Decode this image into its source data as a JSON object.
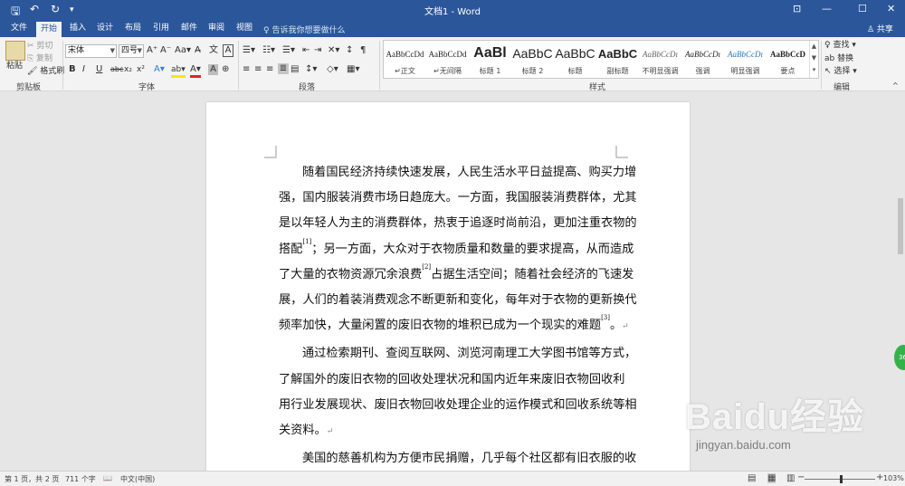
{
  "window": {
    "title": "文档1 - Word",
    "quick_access": {
      "save": "🖫",
      "undo": "↶",
      "redo": "↻",
      "customize": "▾"
    },
    "controls": {
      "ribbon_options": "⊡",
      "minimize": "—",
      "maximize": "☐",
      "close": "✕"
    }
  },
  "tabs": [
    {
      "label": "文件"
    },
    {
      "label": "开始"
    },
    {
      "label": "插入"
    },
    {
      "label": "设计"
    },
    {
      "label": "布局"
    },
    {
      "label": "引用"
    },
    {
      "label": "邮件"
    },
    {
      "label": "审阅"
    },
    {
      "label": "视图"
    }
  ],
  "tell_me": "♀ 告诉我你想要做什么",
  "share": "♙ 共享",
  "ribbon": {
    "clipboard": {
      "label": "剪贴板",
      "paste": "粘贴",
      "cut": "✂ 剪切",
      "copy": "⎘ 复制",
      "format_painter": "🖌 格式刷"
    },
    "font": {
      "label": "字体",
      "font_name": "宋体",
      "font_size": "四号",
      "grow": "A⁺",
      "shrink": "A⁻",
      "case": "Aa▾",
      "clear": "A̶",
      "phonetic": "文",
      "border_char": "A",
      "bold": "B",
      "italic": "I",
      "underline": "U",
      "strike": "abc",
      "subscript": "x₂",
      "superscript": "x²",
      "effects": "A▾",
      "highlight": "ab▾",
      "font_color": "A▾",
      "shading": "A",
      "enclose": "⊕"
    },
    "paragraph": {
      "label": "段落",
      "row1": [
        "☰▾",
        "☷▾",
        "☰▾",
        "⇤",
        "⇥",
        "✕▾",
        "↕",
        "¶",
        "▦"
      ],
      "row2": [
        "≡",
        "≡",
        "≡",
        "≣",
        "▤",
        "↕▾",
        "◇▾",
        "▦▾"
      ]
    },
    "styles": {
      "label": "样式",
      "items": [
        {
          "preview": "AaBbCcDd",
          "name": "↵正文"
        },
        {
          "preview": "AaBbCcDd",
          "name": "↵无间隔"
        },
        {
          "preview": "AaBl",
          "name": "标题 1"
        },
        {
          "preview": "AaBbC",
          "name": "标题 2"
        },
        {
          "preview": "AaBbC",
          "name": "标题"
        },
        {
          "preview": "AaBbC",
          "name": "副标题"
        },
        {
          "preview": "AaBbCcDı",
          "name": "不明显强调"
        },
        {
          "preview": "AaBbCcDı",
          "name": "强调"
        },
        {
          "preview": "AaBbCcDı",
          "name": "明显强调"
        },
        {
          "preview": "AaBbCcD",
          "name": "要点"
        }
      ]
    },
    "editing": {
      "label": "编辑",
      "find": "♀ 查找 ▾",
      "replace": "ab 替换",
      "select": "↖ 选择 ▾"
    }
  },
  "document": {
    "paragraphs": [
      {
        "lines": [
          "随着国民经济持续快速发展，人民生活水平日益提高、购买力增",
          "强，国内服装消费市场日趋庞大。一方面，我国服装消费群体，尤其",
          "是以年轻人为主的消费群体，热衷于追逐时尚前沿，更加注重衣物的",
          "搭配[1]；另一方面，大众对于衣物质量和数量的要求提高，从而造成",
          "了大量的衣物资源冗余浪费[2]占据生活空间；随着社会经济的飞速发",
          "展，人们的着装消费观念不断更新和变化，每年对于衣物的更新换代",
          "频率加快，大量闲置的废旧衣物的堆积已成为一个现实的难题[3]。↵"
        ]
      },
      {
        "lines": [
          "通过检索期刊、查阅互联网、浏览河南理工大学图书馆等方式，",
          "了解国外的废旧衣物的回收处理状况和国内近年来废旧衣物回收利",
          "用行业发展现状、废旧衣物回收处理企业的运作模式和回收系统等相",
          "关资料。↵"
        ]
      },
      {
        "lines": [
          "美国的慈善机构为方便市民捐赠，几乎每个社区都有旧衣服的收"
        ]
      }
    ]
  },
  "status": {
    "page": "第 1 页，共 2 页",
    "words": "711 个字",
    "proof": "📖",
    "language": "中文(中国)",
    "view_read": "▤",
    "view_print": "▦",
    "view_web": "▥",
    "zoom_out": "−",
    "zoom_in": "+",
    "zoom": "103%",
    "zoom_level": 0.515
  },
  "side_badge": "36",
  "watermark": {
    "brand": "Baidu经验",
    "url": "jingyan.baidu.com"
  }
}
